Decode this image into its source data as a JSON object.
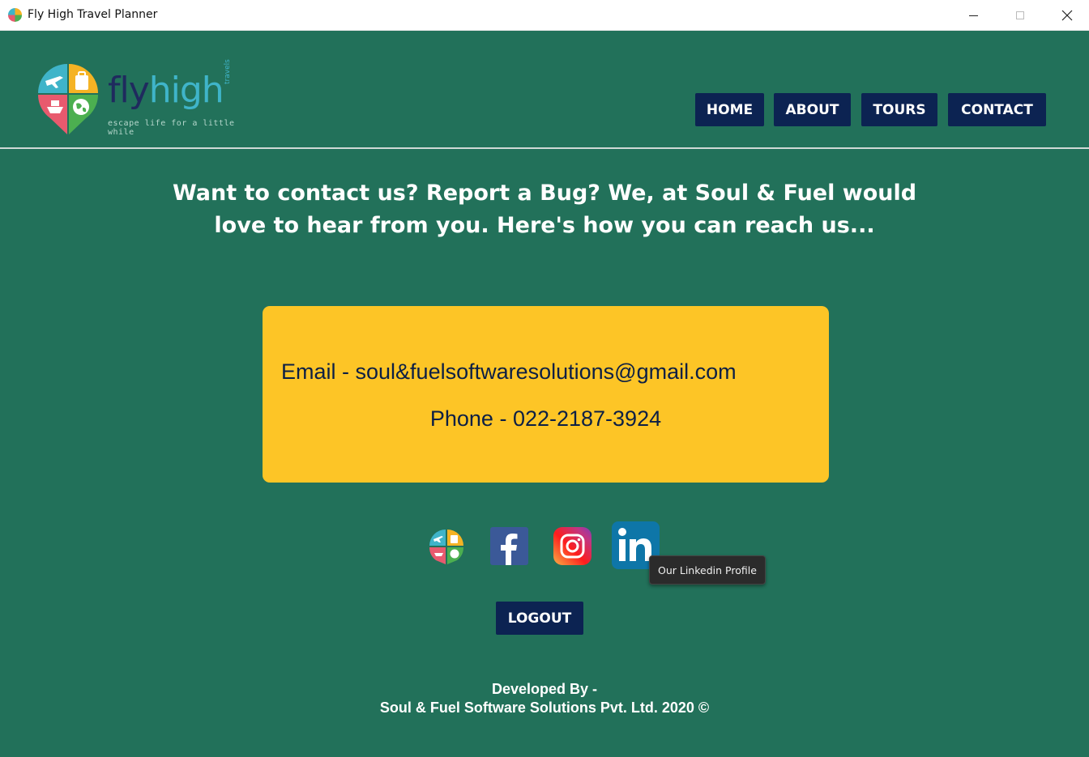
{
  "window": {
    "title": "Fly High Travel Planner",
    "app_icon": "flyhigh-pin-icon",
    "controls": [
      "minimize-icon",
      "maximize-icon",
      "close-icon"
    ]
  },
  "header": {
    "logo": {
      "word_fly": "fly",
      "word_high": "high",
      "word_travels": "travels",
      "tagline": "escape life for a little while"
    },
    "nav": {
      "home": "HOME",
      "about": "ABOUT",
      "tours": "TOURS",
      "contact": "CONTACT"
    }
  },
  "main": {
    "intro_line1": "Want to contact us? Report a Bug? We, at Soul & Fuel would",
    "intro_line2": "love to hear from you. Here's how you can reach us...",
    "contact": {
      "email_label": "Email  -  soul&fuelsoftwaresolutions@gmail.com",
      "phone_label": "Phone  -  022-2187-3924"
    },
    "social": {
      "icons": [
        "flyhigh-logo-icon",
        "facebook-icon",
        "instagram-icon",
        "linkedin-icon"
      ],
      "tooltip": "Our Linkedin Profile"
    },
    "logout_label": "LOGOUT"
  },
  "footer": {
    "line1": "Developed By -",
    "line2": "Soul & Fuel Software Solutions Pvt. Ltd. 2020 ©"
  },
  "colors": {
    "background": "#22715a",
    "nav_button": "#0c2352",
    "card": "#fdc526",
    "text_dark": "#0c1f45"
  }
}
